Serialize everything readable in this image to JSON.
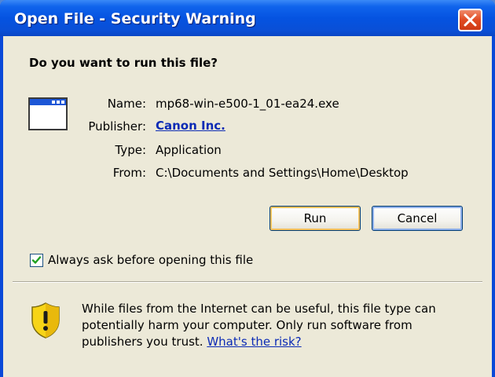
{
  "window": {
    "title": "Open File - Security Warning"
  },
  "dialog": {
    "question": "Do you want to run this file?",
    "fields": {
      "name_label": "Name:",
      "name_value": "mp68-win-e500-1_01-ea24.exe",
      "publisher_label": "Publisher:",
      "publisher_value": "Canon Inc.",
      "type_label": "Type:",
      "type_value": "Application",
      "from_label": "From:",
      "from_value": "C:\\Documents and Settings\\Home\\Desktop"
    },
    "buttons": {
      "run": "Run",
      "cancel": "Cancel"
    },
    "checkbox": {
      "label": "Always ask before opening this file",
      "checked": true
    },
    "warning": {
      "text": "While files from the Internet can be useful, this file type can potentially harm your computer. Only run software from publishers you trust.",
      "link": "What's the risk?"
    }
  },
  "icons": {
    "file": "application-window-icon",
    "security": "shield-warning-icon",
    "close": "close-icon",
    "check": "checkmark-icon"
  },
  "colors": {
    "titlebar": "#0553e1",
    "client_bg": "#ece9d8",
    "link": "#0b2bb5",
    "close_button": "#e04a22",
    "shield_yellow": "#f7d417"
  }
}
